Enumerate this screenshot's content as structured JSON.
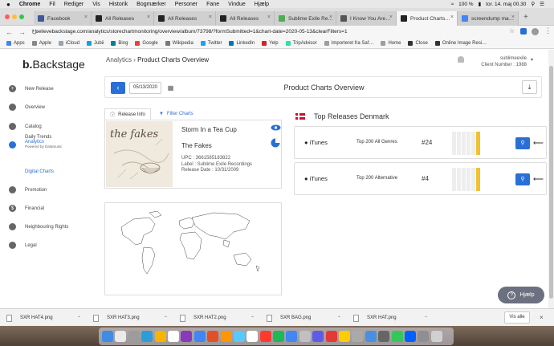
{
  "menubar": {
    "apple_icon": "apple-icon",
    "items": [
      "Chrome",
      "Fil",
      "Rediger",
      "Vis",
      "Historik",
      "Bogmærker",
      "Personer",
      "Fane",
      "Vindue",
      "Hjælp"
    ],
    "battery": "100 %",
    "clock": "tor. 14. maj  00.30"
  },
  "browser_tabs": [
    {
      "label": "Facebook",
      "color": "#3b5998"
    },
    {
      "label": "All Releases",
      "color": "#222222"
    },
    {
      "label": "All Releases",
      "color": "#222222"
    },
    {
      "label": "All Releases",
      "color": "#222222"
    },
    {
      "label": "Sublime Exile Re…",
      "color": "#4caf50"
    },
    {
      "label": "I Know You Are…",
      "color": "#555555"
    },
    {
      "label": "Product Charts…",
      "color": "#222222"
    },
    {
      "label": "screendump ma…",
      "color": "#4285f4"
    }
  ],
  "address": {
    "url": "believebackstage.com/analytics/storechartmonitoring/overview/album/73798/?formSubmitted=1&chart-date=2020-05-13&clearFilters=1"
  },
  "bookmarks": [
    {
      "label": "Apps",
      "color": "#4285f4"
    },
    {
      "label": "Apple",
      "color": "#888888"
    },
    {
      "label": "iCloud",
      "color": "#9aa4ad"
    },
    {
      "label": "Jubii",
      "color": "#1aa0d8"
    },
    {
      "label": "Bing",
      "color": "#00809d"
    },
    {
      "label": "Google",
      "color": "#ea4335"
    },
    {
      "label": "Wikipedia",
      "color": "#777777"
    },
    {
      "label": "Twitter",
      "color": "#1da1f2"
    },
    {
      "label": "LinkedIn",
      "color": "#0077b5"
    },
    {
      "label": "Yelp",
      "color": "#d32323"
    },
    {
      "label": "TripAdvisor",
      "color": "#34e0a1"
    },
    {
      "label": "Importeret fra Saf…",
      "color": "#9e9e9e"
    },
    {
      "label": "Home",
      "color": "#9e9e9e"
    },
    {
      "label": "Close",
      "color": "#333333"
    },
    {
      "label": "Online Image Resi…",
      "color": "#333333"
    }
  ],
  "app": {
    "logo_mark": "b.",
    "logo_text": "Backstage",
    "breadcrumb_parent": "Analytics",
    "breadcrumb_sep": "›",
    "breadcrumb_current": "Product Charts Overview",
    "username": "sublimeexile",
    "client_number": "Client Number : 1988"
  },
  "sidebar": {
    "items": [
      {
        "label": "New Release",
        "icon": "plus-icon"
      },
      {
        "label": "Overview",
        "icon": "grid-icon"
      },
      {
        "label": "Catalog",
        "icon": "disc-icon"
      },
      {
        "label": "Analytics",
        "icon": "chart-icon",
        "sub": "Powered by Datamusic"
      },
      {
        "label": "Promotion",
        "icon": "megaphone-icon"
      },
      {
        "label": "Financial",
        "icon": "dollar-icon"
      },
      {
        "label": "Neighbouring Rights",
        "icon": "rights-icon"
      },
      {
        "label": "Legal",
        "icon": "legal-icon"
      }
    ],
    "sub_items": [
      "Daily Trends",
      "Digital Charts"
    ]
  },
  "header": {
    "date": "05/13/2020",
    "title": "Product Charts Overview"
  },
  "release": {
    "tab_info": "Release Info",
    "tab_filter": "Filter Charts",
    "title": "Storm In a Tea Cup",
    "artist": "The Fakes",
    "upc": "UPC : 3661585183822",
    "label": "Label : Sublime Exile Recordings",
    "release_date": "Release Date : 10/31/2009",
    "cover_text": "the fakes"
  },
  "top_releases": {
    "title": "Top Releases Denmark",
    "flag": "denmark-flag",
    "rows": [
      {
        "store": "iTunes",
        "chart": "Top 200 All Genres",
        "position": "#24",
        "highlight_bar": 5
      },
      {
        "store": "iTunes",
        "chart": "Top 200 Alternative",
        "position": "#4",
        "highlight_bar": 5
      }
    ]
  },
  "help": {
    "label": "Hjælp"
  },
  "downloads": {
    "files": [
      "SXR HAT4.png",
      "SXR HAT3.png",
      "SXR HAT2.png",
      "SXR BAG.png",
      "SXR HAT.png"
    ],
    "show_all": "Vis alle"
  },
  "dock_colors": [
    "#3f8be6",
    "#eaeaea",
    "#9c9c9c",
    "#2d9cdb",
    "#f7b500",
    "#ffffff",
    "#8a3ab9",
    "#4285f4",
    "#e34f26",
    "#ff9500",
    "#5ac8fa",
    "#ffffff",
    "#ff3b30",
    "#1db954",
    "#4285f4",
    "#c0c0c0",
    "#5e5ce6",
    "#e53935",
    "#ffcc00",
    "#aaaaaa",
    "#4a90e2",
    "#666666",
    "#34c759",
    "#0061fe",
    "#8e8e93",
    "#d0d0d0"
  ]
}
